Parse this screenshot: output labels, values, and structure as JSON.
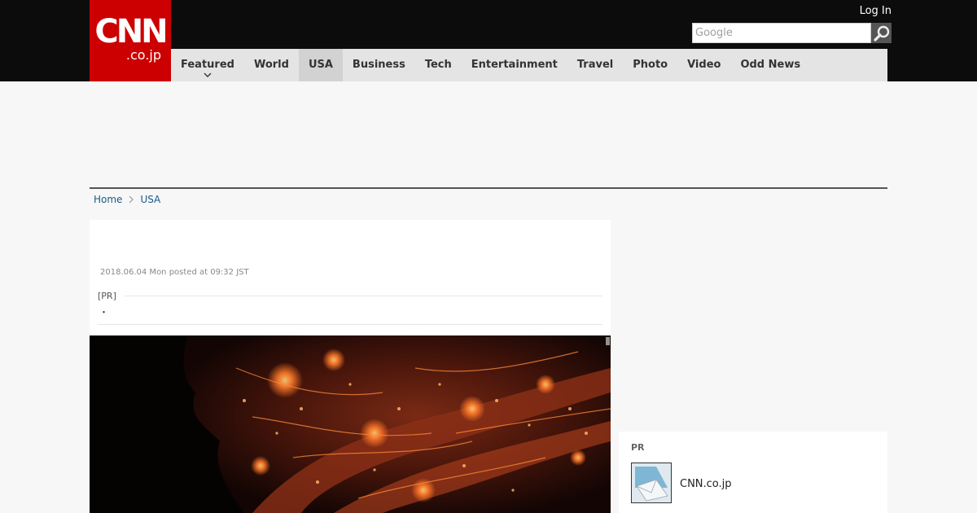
{
  "header": {
    "logo_main": "CNN",
    "logo_sub": ".co.jp",
    "login_label": "Log In",
    "search_placeholder": "Google"
  },
  "nav": {
    "items": [
      {
        "label": "Featured"
      },
      {
        "label": "World"
      },
      {
        "label": "USA"
      },
      {
        "label": "Business"
      },
      {
        "label": "Tech"
      },
      {
        "label": "Entertainment"
      },
      {
        "label": "Travel"
      },
      {
        "label": "Photo"
      },
      {
        "label": "Video"
      },
      {
        "label": "Odd News"
      }
    ],
    "active": "USA"
  },
  "breadcrumb": {
    "items": [
      "Home",
      "USA"
    ]
  },
  "article": {
    "date": "2018.06.04 Mon posted at 09:32 JST",
    "pr_label": "[PR]",
    "pr_text": "・"
  },
  "sidebar": {
    "pr_label": "PR",
    "pr_link": "CNN.co.jp"
  },
  "colors": {
    "brand_red": "#cc0000",
    "header_bg": "#0c0c0c",
    "nav_bg": "#e4e4e4",
    "link_blue": "#1a5a8a"
  }
}
